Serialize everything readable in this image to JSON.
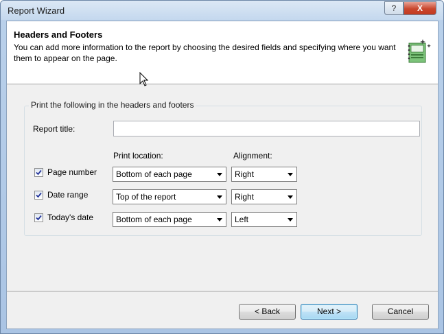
{
  "window": {
    "title": "Report Wizard",
    "help_label": "?",
    "close_label": "X"
  },
  "header": {
    "title": "Headers and Footers",
    "description": "You can add more information to the report by choosing the desired fields and specifying where you want them to appear on the page."
  },
  "group": {
    "title": "Print the following in the headers and footers",
    "report_title_label": "Report title:",
    "report_title_value": "",
    "col_location": "Print location:",
    "col_alignment": "Alignment:",
    "rows": [
      {
        "label": "Page number",
        "checked": true,
        "location": "Bottom of each page",
        "alignment": "Right"
      },
      {
        "label": "Date range",
        "checked": true,
        "location": "Top of the report",
        "alignment": "Right"
      },
      {
        "label": "Today's date",
        "checked": true,
        "location": "Bottom of each page",
        "alignment": "Left"
      }
    ]
  },
  "buttons": {
    "back": "< Back",
    "next": "Next >",
    "cancel": "Cancel"
  }
}
